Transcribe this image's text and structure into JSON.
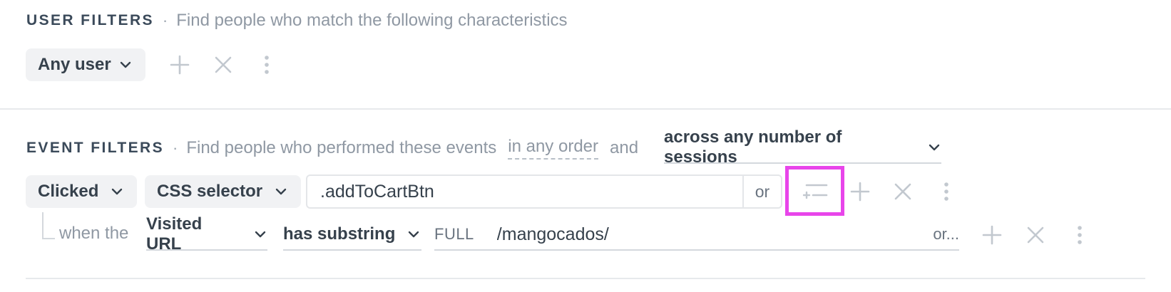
{
  "user_filters": {
    "title": "USER FILTERS",
    "separator": "·",
    "description": "Find people who match the following characteristics",
    "user_select": "Any user"
  },
  "event_filters": {
    "title": "EVENT FILTERS",
    "separator": "·",
    "description": "Find people who performed these events",
    "order_link": "in any order",
    "and_text": "and",
    "sessions_select": "across any number of sessions",
    "event_type": "Clicked",
    "selector_type": "CSS selector",
    "selector_value": ".addToCartBtn",
    "or_button": "or",
    "sub_filter": {
      "prefix": "when the",
      "property": "Visited URL",
      "operator": "has substring",
      "mode": "FULL",
      "value": "/mangocados/",
      "or_button": "or..."
    }
  },
  "colors": {
    "highlight": "#e845ea",
    "pill_bg": "#f1f2f4",
    "icon_gray": "#c2c8cf"
  },
  "icons": [
    "chevron-down-icon",
    "plus-icon",
    "close-icon",
    "more-vertical-icon",
    "add-condition-icon",
    "tree-connector-icon"
  ]
}
